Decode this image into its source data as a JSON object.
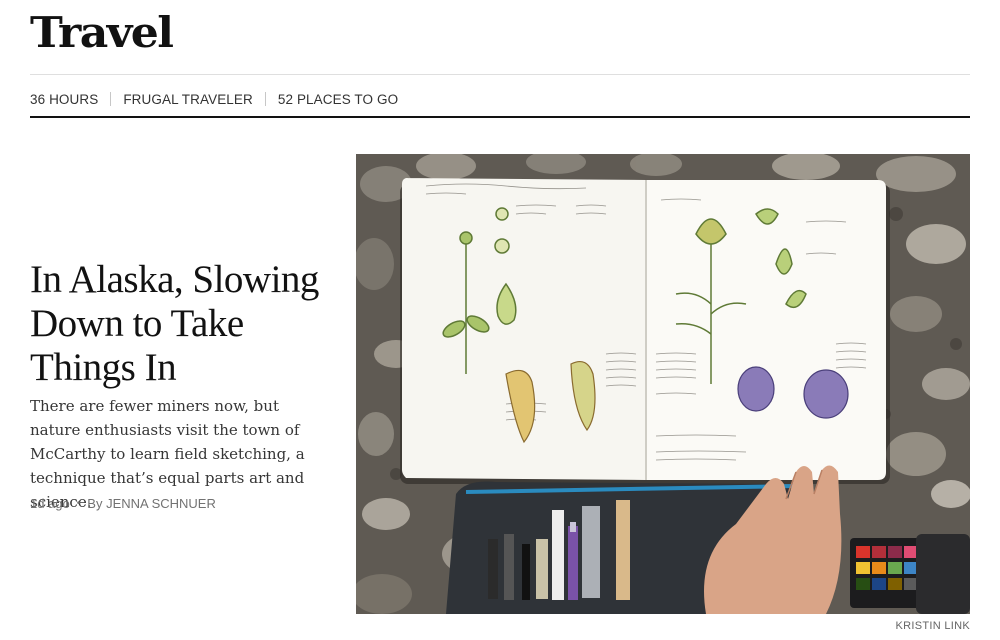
{
  "section": {
    "title": "Travel"
  },
  "subnav": {
    "items": [
      "36 HOURS",
      "FRUGAL TRAVELER",
      "52 PLACES TO GO"
    ]
  },
  "article": {
    "headline": "In Alaska, Slowing Down to Take Things In",
    "summary": "There are fewer miners now, but nature enthusiasts visit the town of McCarthy to learn field sketching, a technique that’s equal parts art and science.",
    "time": "1d ago",
    "byline": "By JENNA SCHNUER",
    "photo_credit": "KRISTIN LINK"
  },
  "colors": {
    "text": "#121212",
    "rule": "#121212",
    "meta": "#727272"
  }
}
